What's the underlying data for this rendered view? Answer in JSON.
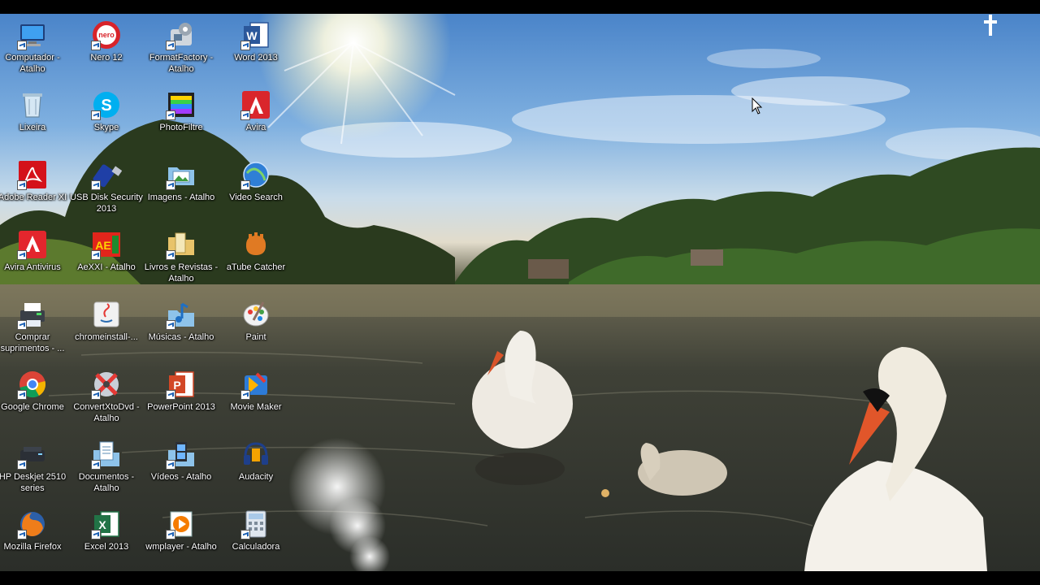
{
  "desktop": {
    "icons": [
      {
        "label": "Computador - Atalho",
        "icon": "computer-icon"
      },
      {
        "label": "Nero 12",
        "icon": "nero-icon"
      },
      {
        "label": "FormatFactory - Atalho",
        "icon": "formatfactory-icon"
      },
      {
        "label": "Word 2013",
        "icon": "word-icon"
      },
      {
        "label": "Lixeira",
        "icon": "recycle-bin-icon"
      },
      {
        "label": "Skype",
        "icon": "skype-icon"
      },
      {
        "label": "PhotoFiltre",
        "icon": "photofiltre-icon"
      },
      {
        "label": "Avira",
        "icon": "avira-icon"
      },
      {
        "label": "Adobe Reader XI",
        "icon": "adobe-reader-icon"
      },
      {
        "label": "USB Disk Security 2013",
        "icon": "usb-disk-security-icon"
      },
      {
        "label": "Imagens - Atalho",
        "icon": "images-folder-icon"
      },
      {
        "label": "Video Search",
        "icon": "video-search-icon"
      },
      {
        "label": "Avira Antivirus",
        "icon": "avira-antivirus-icon"
      },
      {
        "label": "AeXXI - Atalho",
        "icon": "aexxi-icon"
      },
      {
        "label": "Livros e Revistas - Atalho",
        "icon": "folder-icon"
      },
      {
        "label": "aTube Catcher",
        "icon": "atube-catcher-icon"
      },
      {
        "label": "Comprar suprimentos - ...",
        "icon": "printer-supplies-icon"
      },
      {
        "label": "chromeinstall-...",
        "icon": "java-installer-icon"
      },
      {
        "label": "Músicas - Atalho",
        "icon": "music-folder-icon"
      },
      {
        "label": "Paint",
        "icon": "paint-icon"
      },
      {
        "label": "Google Chrome",
        "icon": "chrome-icon"
      },
      {
        "label": "ConvertXtoDvd - Atalho",
        "icon": "convertxtodvd-icon"
      },
      {
        "label": "PowerPoint 2013",
        "icon": "powerpoint-icon"
      },
      {
        "label": "Movie Maker",
        "icon": "movie-maker-icon"
      },
      {
        "label": "HP Deskjet 2510 series",
        "icon": "printer-icon"
      },
      {
        "label": "Documentos - Atalho",
        "icon": "documents-folder-icon"
      },
      {
        "label": "Vídeos - Atalho",
        "icon": "videos-folder-icon"
      },
      {
        "label": "Audacity",
        "icon": "audacity-icon"
      },
      {
        "label": "Mozilla Firefox",
        "icon": "firefox-icon"
      },
      {
        "label": "Excel 2013",
        "icon": "excel-icon"
      },
      {
        "label": "wmplayer - Atalho",
        "icon": "wmplayer-icon"
      },
      {
        "label": "Calculadora",
        "icon": "calculator-icon"
      }
    ]
  },
  "colors": {
    "label_text": "#ffffff",
    "frame": "#000000"
  }
}
